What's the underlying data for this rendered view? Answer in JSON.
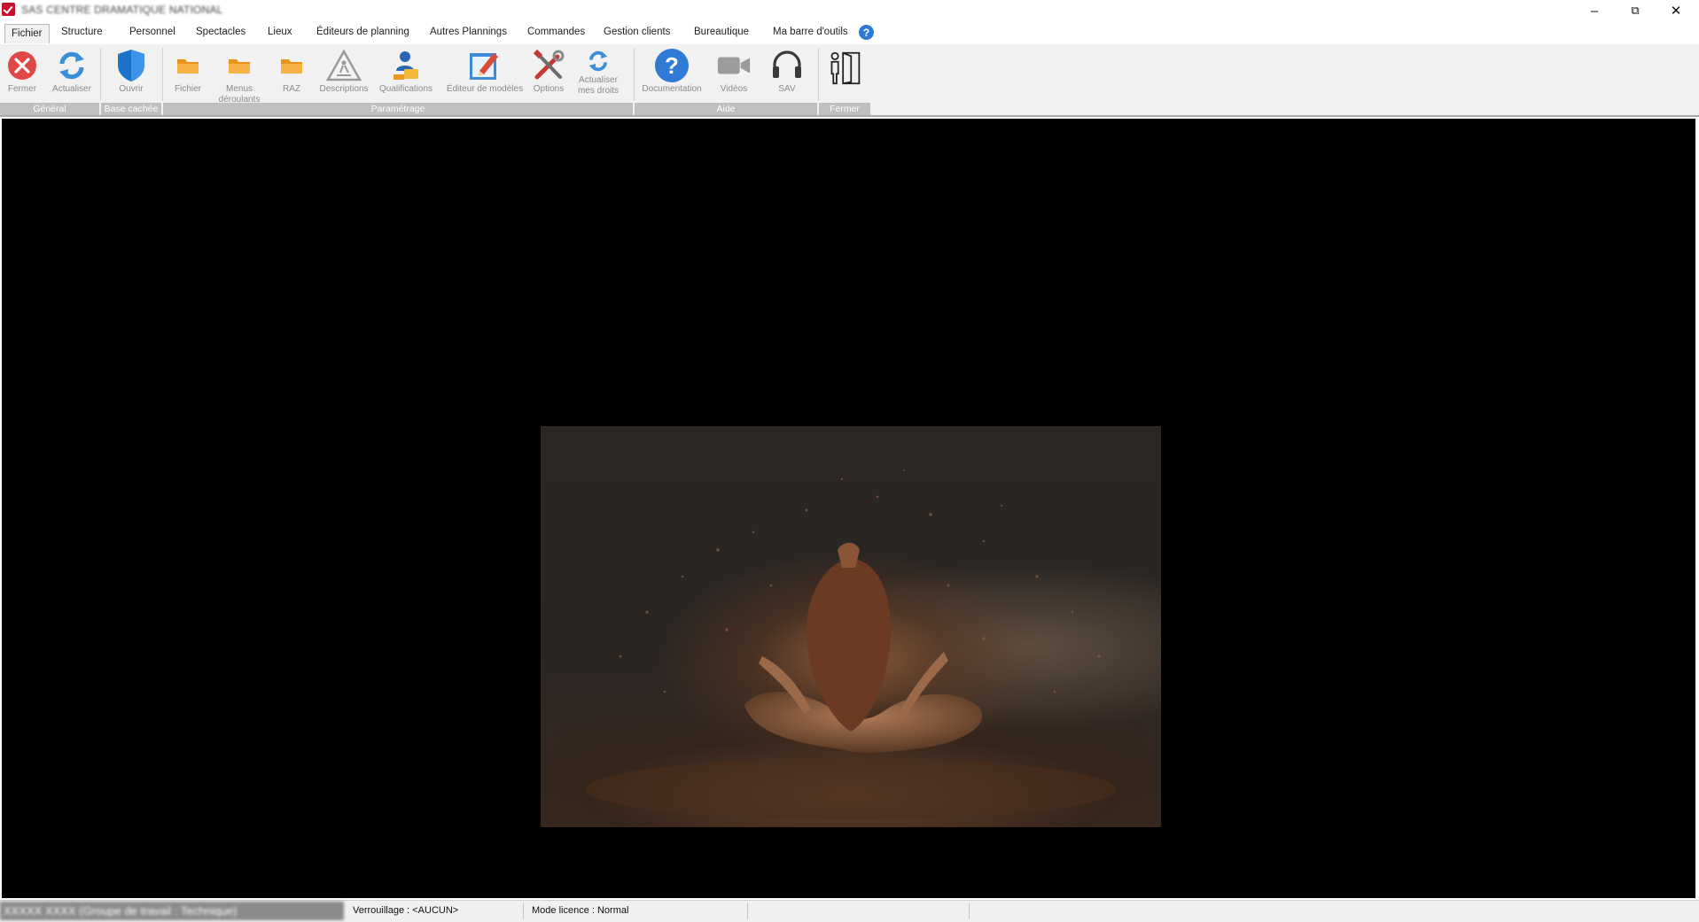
{
  "window": {
    "title": "SAS CENTRE DRAMATIQUE NATIONAL",
    "minimize_glyph": "–",
    "restore_glyph": "⧉",
    "close_glyph": "✕"
  },
  "tabs": [
    {
      "label": "Fichier",
      "active": true
    },
    {
      "label": "Structure"
    },
    {
      "label": "Personnel"
    },
    {
      "label": "Spectacles"
    },
    {
      "label": "Lieux"
    },
    {
      "label": "Éditeurs de planning"
    },
    {
      "label": "Autres Plannings"
    },
    {
      "label": "Commandes"
    },
    {
      "label": "Gestion clients"
    },
    {
      "label": "Bureautique"
    },
    {
      "label": "Ma barre d'outils"
    }
  ],
  "help_glyph": "?",
  "ribbon": {
    "buttons": [
      {
        "label": "Fermer",
        "icon": "close-circle-icon"
      },
      {
        "label": "Actualiser",
        "icon": "refresh-icon"
      },
      {
        "label": "Ouvrir",
        "icon": "shield-icon"
      },
      {
        "label": "Fichier",
        "icon": "folder-icon"
      },
      {
        "label": "Menus\ndéroulants",
        "icon": "folder-icon"
      },
      {
        "label": "RAZ",
        "icon": "folder-icon"
      },
      {
        "label": "Descriptions",
        "icon": "warning-construction-icon"
      },
      {
        "label": "Qualifications",
        "icon": "worker-icon"
      },
      {
        "label": "Éditeur de modèles",
        "icon": "edit-template-icon"
      },
      {
        "label": "Options",
        "icon": "tools-icon"
      },
      {
        "label": "Actualiser\nmes droits",
        "icon": "refresh-icon"
      },
      {
        "label": "Documentation",
        "icon": "help-circle-icon"
      },
      {
        "label": "Vidéos",
        "icon": "video-camera-icon"
      },
      {
        "label": "SAV",
        "icon": "headset-icon"
      },
      {
        "label": "",
        "icon": "exit-door-icon"
      }
    ],
    "groups": [
      {
        "label": "Général"
      },
      {
        "label": "Base cachée"
      },
      {
        "label": "Paramétrage"
      },
      {
        "label": "Aide"
      },
      {
        "label": "Fermer"
      }
    ]
  },
  "colors": {
    "ribbon_bg": "#f1f1f1",
    "group_label_bg": "#bfbfbf",
    "accent_blue": "#2f7ad4",
    "close_red": "#e04848",
    "folder_orange": "#f5a623",
    "main_bg": "#000000"
  },
  "status": {
    "user": "XXXXX XXXX (Groupe de travail : Technique)",
    "lock": "Verrouillage : <AUCUN>",
    "license": "Mode licence : Normal"
  }
}
